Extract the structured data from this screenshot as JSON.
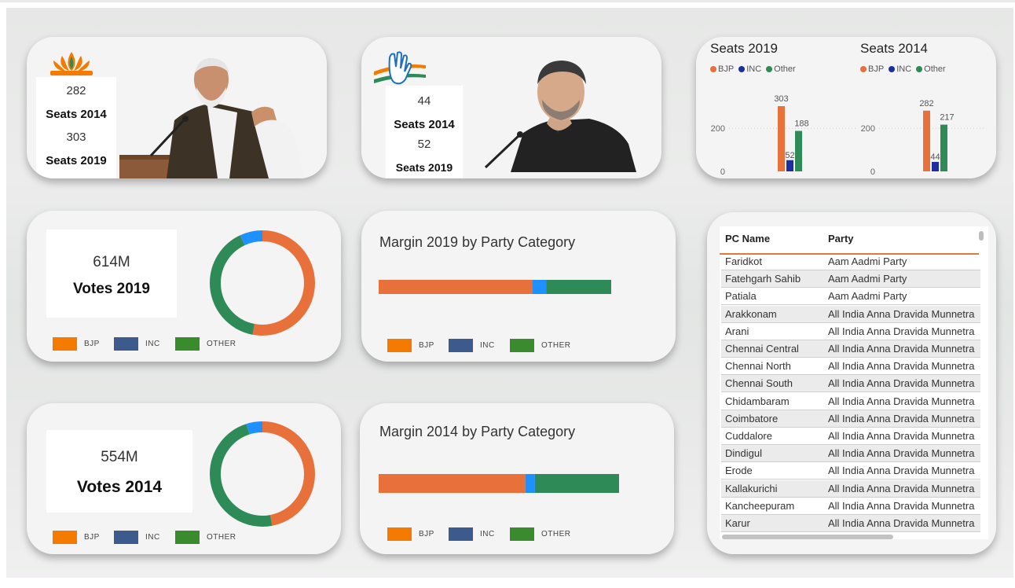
{
  "colors": {
    "bjp": "#e8703a",
    "inc": "#1d2f9e",
    "other": "#2e8b57",
    "legend_bjp": "#f47a00",
    "legend_inc": "#3d5a8c",
    "legend_other": "#3a8a2e",
    "donut_inc": "#1e90ff"
  },
  "bjp_card": {
    "logo_icon": "lotus-logo-icon",
    "seats_2014_value": "282",
    "seats_2014_label": "Seats 2014",
    "seats_2019_value": "303",
    "seats_2019_label": "Seats 2019"
  },
  "inc_card": {
    "logo_icon": "hand-logo-icon",
    "seats_2014_value": "44",
    "seats_2014_label": "Seats 2014",
    "seats_2019_value": "52",
    "seats_2019_label": "Seats 2019"
  },
  "chart_data": [
    {
      "type": "bar",
      "title": "Seats 2019",
      "legend": [
        "BJP",
        "INC",
        "Other"
      ],
      "legend_position": "top-left",
      "categories": [
        "BJP",
        "INC",
        "Other"
      ],
      "values": [
        303,
        52,
        188
      ],
      "ylim": [
        0,
        303
      ],
      "yticks": [
        0,
        200
      ],
      "grid": true
    },
    {
      "type": "bar",
      "title": "Seats 2014",
      "legend": [
        "BJP",
        "INC",
        "Other"
      ],
      "legend_position": "top-left",
      "categories": [
        "BJP",
        "INC",
        "Other"
      ],
      "values": [
        282,
        44,
        217
      ],
      "ylim": [
        0,
        303
      ],
      "yticks": [
        0,
        200
      ],
      "grid": true
    }
  ],
  "votes_2019": {
    "value": "614M",
    "label": "Votes 2019",
    "donut_shares": {
      "bjp": 0.53,
      "inc": 0.07,
      "other": 0.4
    },
    "legend": [
      "BJP",
      "INC",
      "OTHER"
    ]
  },
  "votes_2014": {
    "value": "554M",
    "label": "Votes 2014",
    "donut_shares": {
      "bjp": 0.47,
      "inc": 0.05,
      "other": 0.48
    },
    "legend": [
      "BJP",
      "INC",
      "OTHER"
    ]
  },
  "margin_2019": {
    "title": "Margin 2019 by Party Category",
    "shares": {
      "bjp": 0.66,
      "inc": 0.06,
      "other": 0.28
    },
    "legend": [
      "BJP",
      "INC",
      "OTHER"
    ]
  },
  "margin_2014": {
    "title": "Margin 2014 by Party Category",
    "shares": {
      "bjp": 0.61,
      "inc": 0.04,
      "other": 0.35
    },
    "legend": [
      "BJP",
      "INC",
      "OTHER"
    ]
  },
  "table": {
    "headers": [
      "PC Name",
      "Party"
    ],
    "rows": [
      [
        "Faridkot",
        "Aam Aadmi Party"
      ],
      [
        "Fatehgarh Sahib",
        "Aam Aadmi Party"
      ],
      [
        "Patiala",
        "Aam Aadmi Party"
      ],
      [
        "Arakkonam",
        "All India Anna Dravida Munnetra"
      ],
      [
        "Arani",
        "All India Anna Dravida Munnetra"
      ],
      [
        "Chennai Central",
        "All India Anna Dravida Munnetra"
      ],
      [
        "Chennai North",
        "All India Anna Dravida Munnetra"
      ],
      [
        "Chennai South",
        "All India Anna Dravida Munnetra"
      ],
      [
        "Chidambaram",
        "All India Anna Dravida Munnetra"
      ],
      [
        "Coimbatore",
        "All India Anna Dravida Munnetra"
      ],
      [
        "Cuddalore",
        "All India Anna Dravida Munnetra"
      ],
      [
        "Dindigul",
        "All India Anna Dravida Munnetra"
      ],
      [
        "Erode",
        "All India Anna Dravida Munnetra"
      ],
      [
        "Kallakurichi",
        "All India Anna Dravida Munnetra"
      ],
      [
        "Kancheepuram",
        "All India Anna Dravida Munnetra"
      ],
      [
        "Karur",
        "All India Anna Dravida Munnetra"
      ]
    ]
  }
}
